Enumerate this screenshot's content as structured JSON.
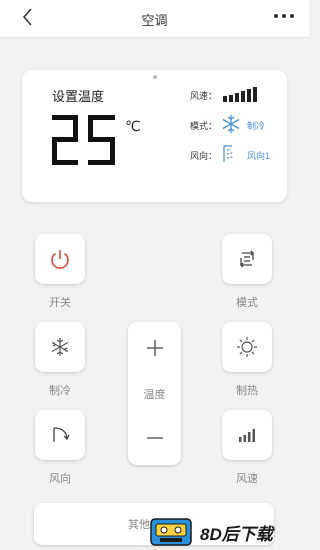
{
  "header": {
    "title": "空调"
  },
  "status": {
    "set_temp_label": "设置温度",
    "temperature": "25",
    "unit": "℃",
    "fan_speed_label": "风速：",
    "fan_speed_level": 5,
    "mode_label": "模式：",
    "mode_value": "制冷",
    "direction_label": "风向：",
    "direction_value": "风向1"
  },
  "controls": {
    "power": "开关",
    "mode": "模式",
    "cool": "制冷",
    "heat": "制热",
    "temperature": "温度",
    "swing": "风向",
    "fan_speed": "风速",
    "other": "其他"
  },
  "watermark": {
    "text": "8D后下载"
  },
  "colors": {
    "accent": "#4a90d9",
    "power_red": "#e64340"
  }
}
